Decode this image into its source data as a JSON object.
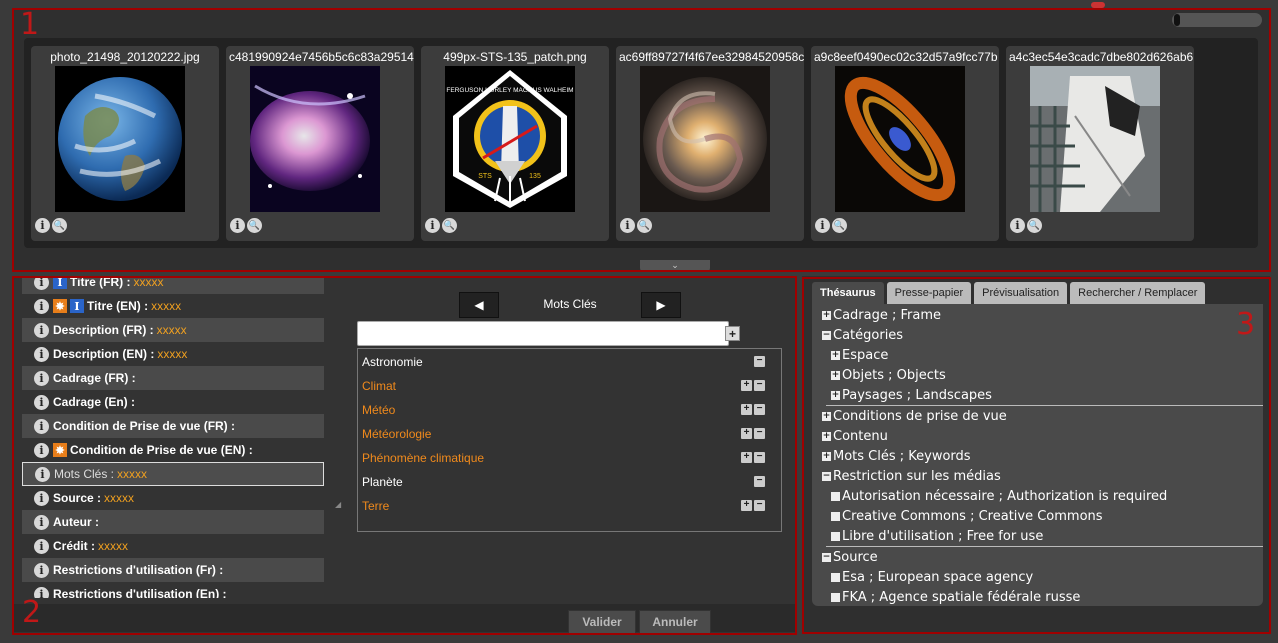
{
  "regions": {
    "top": "1",
    "left": "2",
    "right": "3"
  },
  "thumbnails": [
    {
      "name": "photo_21498_20120222.jpg",
      "image": "earth"
    },
    {
      "name": "c481990924e7456b5c6c83a29514",
      "image": "nebula-pink"
    },
    {
      "name": "499px-STS-135_patch.png",
      "image": "sts-135-patch"
    },
    {
      "name": "ac69ff89727f4f67ee32984520958c",
      "image": "spiral-galaxy"
    },
    {
      "name": "a9c8eef0490ec02c32d57a9fcc77b",
      "image": "andromeda"
    },
    {
      "name": "a4c3ec54e3cadc7dbe802d626ab6",
      "image": "shuttle"
    }
  ],
  "patch": {
    "top_arc": "FERGUSON HURLEY MAGNUS WALHEIM",
    "left": "STS",
    "right": "135"
  },
  "fields": [
    {
      "label": "Titre (FR) :",
      "value": "xxxxx",
      "alt": true
    },
    {
      "label": "Titre (EN) :",
      "value": "xxxxx",
      "alt": false
    },
    {
      "label": "Description (FR) :",
      "value": "xxxxx",
      "alt": true
    },
    {
      "label": "Description (EN) :",
      "value": "xxxxx",
      "alt": false
    },
    {
      "label": "Cadrage (FR) :",
      "value": "",
      "alt": true
    },
    {
      "label": "Cadrage (En) :",
      "value": "",
      "alt": false
    },
    {
      "label": "Condition de Prise de vue (FR) :",
      "value": "",
      "alt": true
    },
    {
      "label": "Condition de Prise de vue (EN) :",
      "value": "",
      "alt": false
    },
    {
      "label": "Mots Clés :",
      "value": "xxxxx",
      "alt": false,
      "selected": true
    },
    {
      "label": "Source :",
      "value": "xxxxx",
      "alt": false
    },
    {
      "label": "Auteur :",
      "value": "",
      "alt": true
    },
    {
      "label": "Crédit :",
      "value": "xxxxx",
      "alt": false
    },
    {
      "label": "Restrictions d'utilisation (Fr) :",
      "value": "",
      "alt": true
    },
    {
      "label": "Restrictions d'utilisation (En) :",
      "value": "",
      "alt": false
    }
  ],
  "keywords": {
    "title": "Mots Clés",
    "prev_icon": "◀",
    "next_icon": "▶",
    "add_icon": "+",
    "input_value": "",
    "items": [
      {
        "label": "Astronomie",
        "color": "white",
        "plus": false
      },
      {
        "label": "Climat",
        "color": "orange",
        "plus": true
      },
      {
        "label": "Météo",
        "color": "orange",
        "plus": true
      },
      {
        "label": "Météorologie",
        "color": "orange",
        "plus": true
      },
      {
        "label": "Phénomène climatique",
        "color": "orange",
        "plus": true
      },
      {
        "label": "Planète",
        "color": "white",
        "plus": false
      },
      {
        "label": "Terre",
        "color": "orange",
        "plus": true
      }
    ]
  },
  "actions": {
    "validate": "Valider",
    "cancel": "Annuler"
  },
  "tabs": [
    {
      "label": "Thésaurus",
      "active": true
    },
    {
      "label": "Presse-papier",
      "active": false
    },
    {
      "label": "Prévisualisation",
      "active": false
    },
    {
      "label": "Rechercher / Remplacer",
      "active": false
    }
  ],
  "tree": [
    {
      "label": "Cadrage ; Frame",
      "level": 0,
      "box": "+"
    },
    {
      "label": "Catégories",
      "level": 0,
      "box": "-"
    },
    {
      "label": "Espace",
      "level": 1,
      "box": "+"
    },
    {
      "label": "Objets ; Objects",
      "level": 1,
      "box": "+"
    },
    {
      "label": "Paysages ; Landscapes",
      "level": 1,
      "box": "+"
    },
    {
      "sep": true
    },
    {
      "label": "Conditions de prise de vue",
      "level": 0,
      "box": "+"
    },
    {
      "label": "Contenu",
      "level": 0,
      "box": "+"
    },
    {
      "label": "Mots Clés ; Keywords",
      "level": 0,
      "box": "+"
    },
    {
      "label": "Restriction sur les médias",
      "level": 0,
      "box": "-"
    },
    {
      "label": "Autorisation nécessaire ; Authorization is required",
      "level": 1,
      "box": ""
    },
    {
      "label": "Creative Commons ; Creative Commons",
      "level": 1,
      "box": ""
    },
    {
      "label": "Libre d'utilisation ; Free for use",
      "level": 1,
      "box": ""
    },
    {
      "sep": true
    },
    {
      "label": "Source",
      "level": 0,
      "box": "-"
    },
    {
      "label": "Esa ; European space agency",
      "level": 1,
      "box": ""
    },
    {
      "label": "FKA ; Agence spatiale fédérale russe",
      "level": 1,
      "box": ""
    }
  ],
  "colors": {
    "accent_orange": "#f08a1c",
    "region_red": "#a00000"
  }
}
